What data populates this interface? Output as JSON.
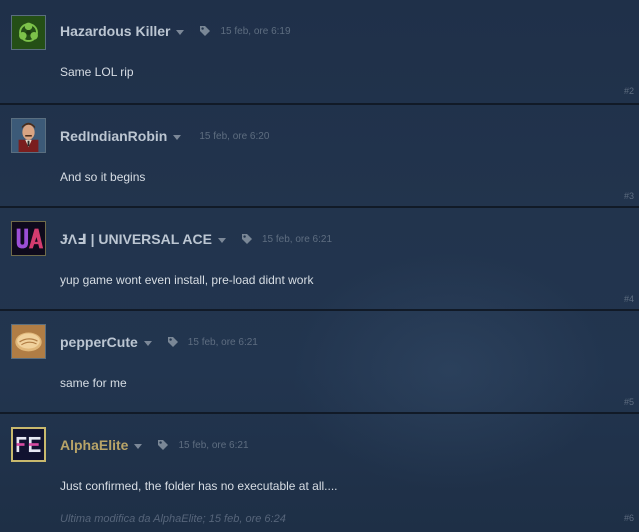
{
  "posts": [
    {
      "author": "Hazardous Killer",
      "date": "15 feb, ore 6:19",
      "text": "Same LOL rip",
      "number": "#2",
      "avatar_icon": "biohazard-avatar-icon",
      "badge": true
    },
    {
      "author": "RedIndianRobin",
      "date": "15 feb, ore 6:20",
      "text": "And so it begins",
      "number": "#3",
      "avatar_icon": "anchorman-avatar-icon",
      "badge": false
    },
    {
      "author": "ɈΛℲ | UNIVERSAL ACE",
      "date": "15 feb, ore 6:21",
      "text": "yup game wont even install, pre-load didnt work",
      "number": "#4",
      "avatar_icon": "ua-logo-avatar-icon",
      "badge": true
    },
    {
      "author": "pepperCute",
      "date": "15 feb, ore 6:21",
      "text": "same for me",
      "number": "#5",
      "avatar_icon": "pancake-avatar-icon",
      "badge": true
    },
    {
      "author": "AlphaElite",
      "date": "15 feb, ore 6:21",
      "text": "Just confirmed, the folder has no executable at all....",
      "number": "#6",
      "avatar_icon": "fe-logo-avatar-icon",
      "badge": true,
      "edited": "Ultima modifica da AlphaElite; 15 feb, ore 6:24"
    }
  ],
  "colors": {
    "background": "#22344d",
    "author": "#bcc6d2",
    "author_gold": "#b8a468",
    "meta": "#5e6d80",
    "text": "#d7dde4",
    "separator": "#111a27"
  }
}
